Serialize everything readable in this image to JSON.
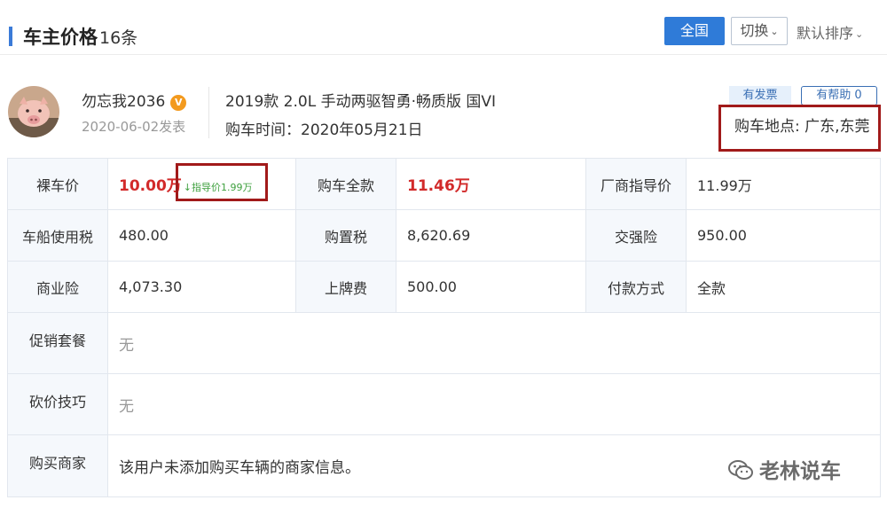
{
  "header": {
    "title": "车主价格",
    "count": "16条",
    "region_button": "全国",
    "switch_button": "切换",
    "sort_label": "默认排序"
  },
  "post": {
    "username": "勿忘我2036",
    "badge": "V",
    "date": "2020-06-02发表",
    "car_model": "2019款 2.0L 手动两驱智勇·畅质版 国VI",
    "purchase_time": "购车时间：2020年05月21日",
    "tag_invoice": "有发票",
    "tag_helpful": "有帮助 0",
    "location": "购车地点: 广东,东莞"
  },
  "table": {
    "row1": {
      "label1": "裸车价",
      "value1": "10.00万",
      "guide_note": "↓指导价1.99万",
      "label2": "购车全款",
      "value2": "11.46万",
      "label3": "厂商指导价",
      "value3": "11.99万"
    },
    "row2": {
      "label1": "车船使用税",
      "value1": "480.00",
      "label2": "购置税",
      "value2": "8,620.69",
      "label3": "交强险",
      "value3": "950.00"
    },
    "row3": {
      "label1": "商业险",
      "value1": "4,073.30",
      "label2": "上牌费",
      "value2": "500.00",
      "label3": "付款方式",
      "value3": "全款"
    },
    "promo_label": "促销套餐",
    "promo_value": "无",
    "bargain_label": "砍价技巧",
    "bargain_value": "无",
    "dealer_label": "购买商家",
    "dealer_value": "该用户未添加购买车辆的商家信息。"
  },
  "watermark": "老林说车",
  "colors": {
    "accent": "#2f7bd8",
    "price_red": "#d22a2a",
    "highlight_box": "#a11a1a"
  }
}
